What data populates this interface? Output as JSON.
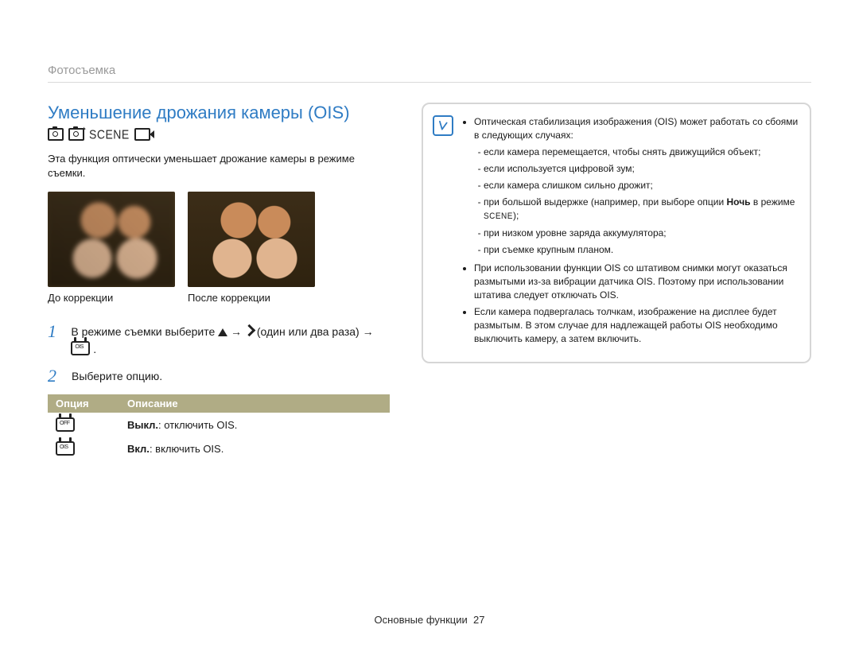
{
  "breadcrumb": "Фотосъемка",
  "title": "Уменьшение дрожания камеры (OIS)",
  "description": "Эта функция оптически уменьшает дрожание камеры в режиме съемки.",
  "photos": {
    "before_caption": "До коррекции",
    "after_caption": "После коррекции"
  },
  "steps": {
    "s1_num": "1",
    "s1a": "В режиме съемки выберите ",
    "s1b": " → ",
    "s1c": " (один или два раза) → ",
    "s1d": " .",
    "s2_num": "2",
    "s2": "Выберите опцию."
  },
  "options_table": {
    "header_option": "Опция",
    "header_desc": "Описание",
    "rows": [
      {
        "icon_label": "OFF",
        "bold": "Выкл.",
        "rest": ": отключить OIS."
      },
      {
        "icon_label": "OIS",
        "bold": "Вкл.",
        "rest": ": включить OIS."
      }
    ]
  },
  "note": {
    "b1": "Оптическая стабилизация изображения (OIS) может работать со сбоями в следующих случаях:",
    "b1_items": [
      "если камера перемещается, чтобы снять движущийся объект;",
      "если используется цифровой зум;",
      "если камера слишком сильно дрожит;",
      "при большой выдержке (например, при выборе опции Ночь в режиме SCENE);",
      "при низком уровне заряда аккумулятора;",
      "при съемке крупным планом."
    ],
    "b2": "При использовании функции OIS со штативом снимки могут оказаться размытыми из-за вибрации датчика OIS. Поэтому при использовании штатива следует отключать OIS.",
    "b3": "Если камера подвергалась толчкам, изображение на дисплее будет размытым. В этом случае для надлежащей работы OIS необходимо выключить камеру, а затем включить."
  },
  "footer_section": "Основные функции",
  "footer_page": "27"
}
